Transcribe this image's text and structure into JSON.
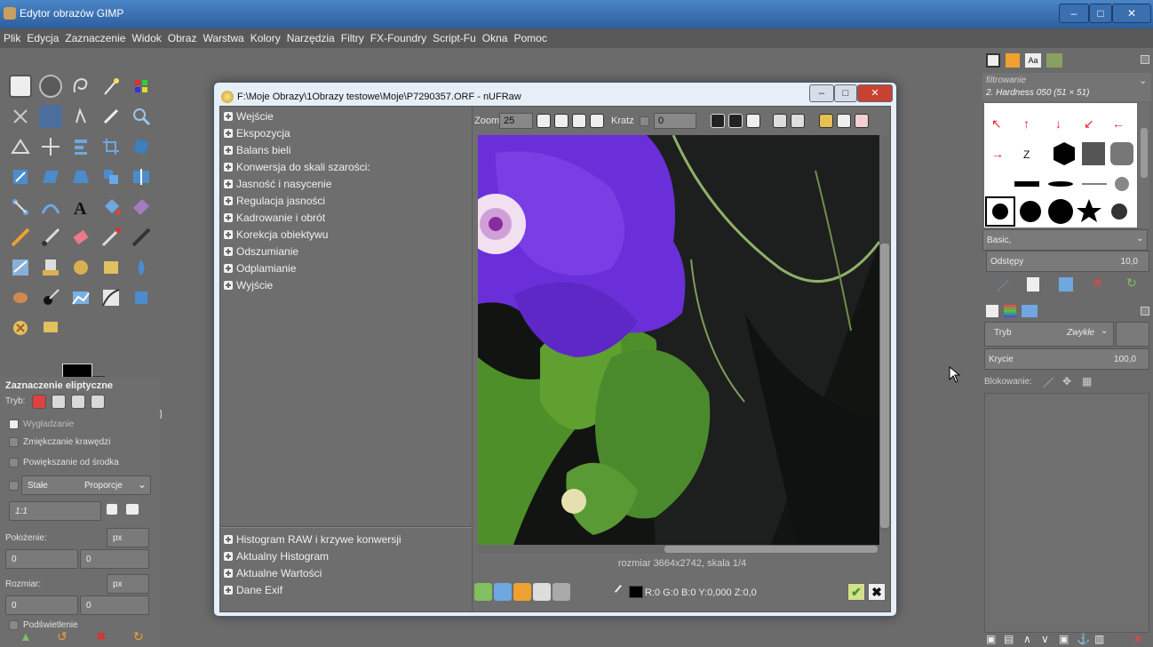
{
  "window": {
    "title": "Edytor obrazów GIMP",
    "minimize": "–",
    "maximize": "□",
    "close": "✕"
  },
  "menu": [
    "Plik",
    "Edycja",
    "Zaznaczenie",
    "Widok",
    "Obraz",
    "Warstwa",
    "Kolory",
    "Narzędzia",
    "Filtry",
    "FX-Foundry",
    "Script-Fu",
    "Okna",
    "Pomoc"
  ],
  "tool_options": {
    "title": "Zaznaczenie eliptyczne",
    "mode_label": "Tryb:",
    "antialias": "Wygładzanie",
    "feather": "Zmiękczanie krawędzi",
    "expand_center": "Powiększanie od środka",
    "fixed_label": "Stałe",
    "fixed_option": "Proporcje",
    "ratio_value": "1:1",
    "position_label": "Położenie:",
    "position_unit": "px",
    "position_x": "0",
    "position_y": "0",
    "size_label": "Rozmiar:",
    "size_unit": "px",
    "size_x": "0",
    "size_y": "0",
    "highlight": "Podświetlenie"
  },
  "dialog": {
    "title": "F:\\Moje Obrazy\\1Obrazy testowe\\Moje\\P7290357.ORF - nUFRaw",
    "sections": [
      "Wejście",
      "Ekspozycja",
      "Balans bieli",
      "Konwersja do skali szarości:",
      "Jasność i nasycenie",
      "Regulacja jasności",
      "Kadrowanie i obrót",
      "Korekcja obiektywu",
      "Odszumianie",
      "Odplamianie",
      "Wyjście"
    ],
    "lower_sections": [
      "Histogram RAW i krzywe konwersji",
      "Aktualny Histogram",
      "Aktualne Wartości",
      "Dane Exif"
    ],
    "zoom_label": "Zoom",
    "zoom_value": "25",
    "grid_label": "Kratz",
    "grid_value": "0",
    "size_text": "rozmiar 3664x2742, skala 1/4",
    "pixel_readout": "R:0 G:0 B:0 Y:0,000 Z:0,0"
  },
  "dock": {
    "brush_filter": "filtrowanie",
    "brush_name": "2. Hardness 050 (51 × 51)",
    "brush_set": "Basic,",
    "spacing_label": "Odstępy",
    "spacing_value": "10,0",
    "mode_label": "Tryb",
    "mode_value": "Zwykłe",
    "opacity_label": "Krycie",
    "opacity_value": "100,0",
    "lock_label": "Blokowanie:"
  },
  "colors": {
    "accent": "#2d5e9e",
    "flower": "#6a2fd8",
    "leaf": "#4f8f2a"
  }
}
